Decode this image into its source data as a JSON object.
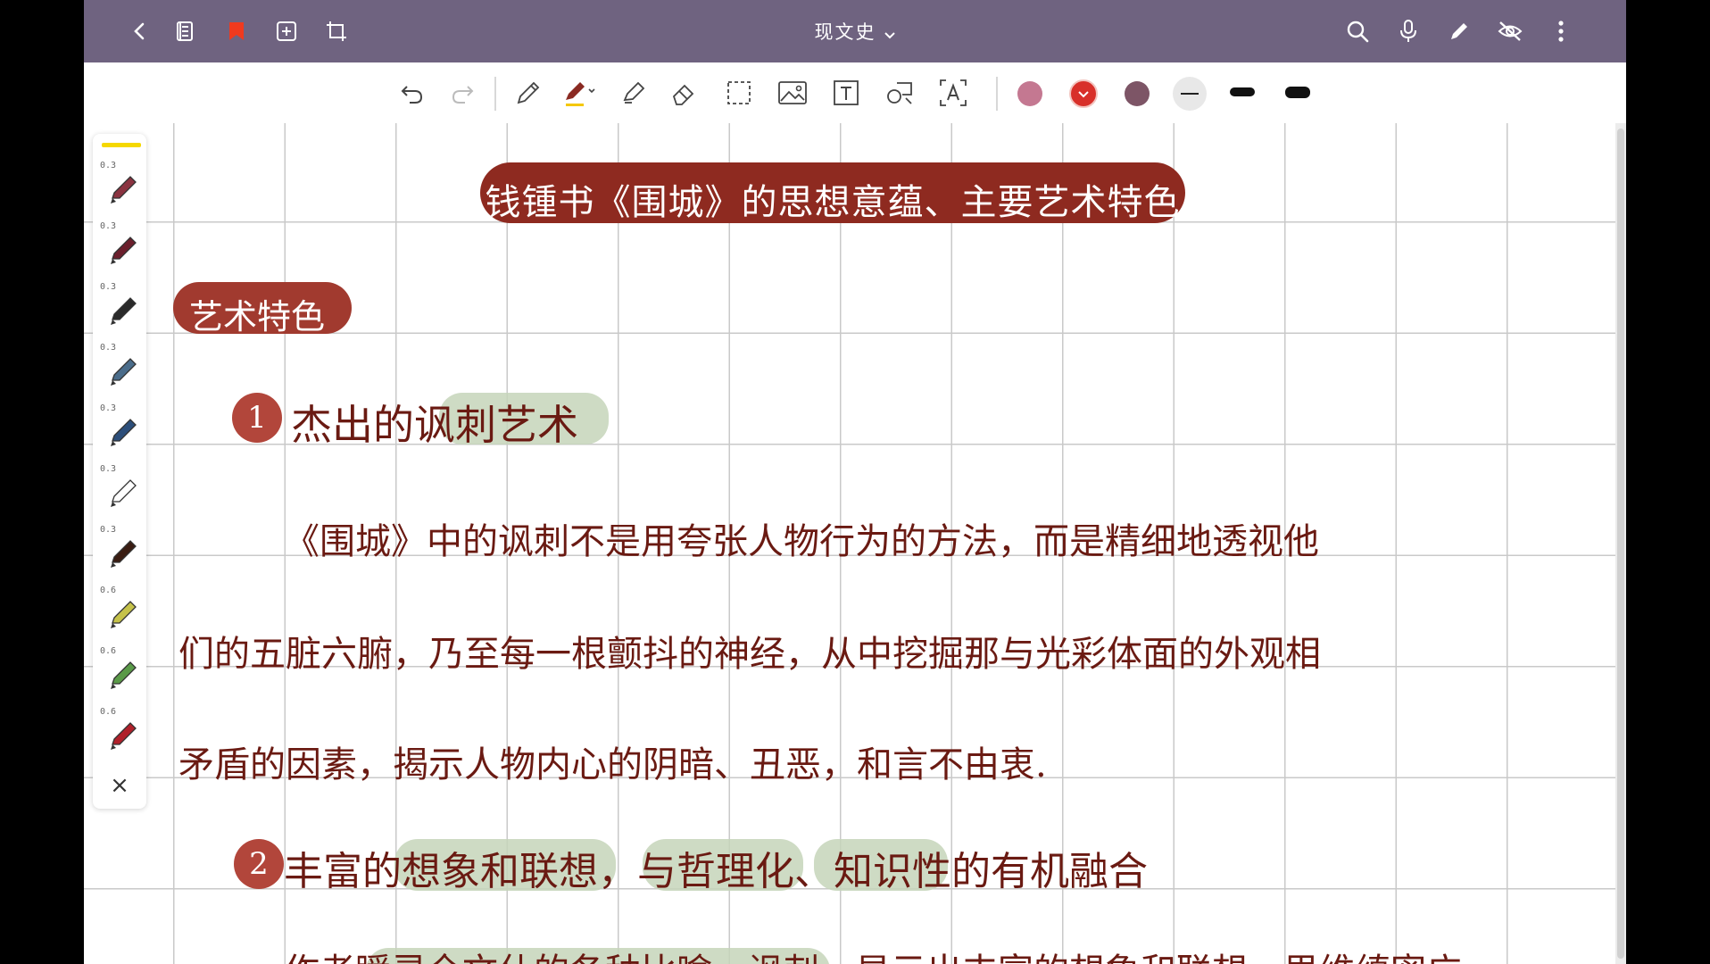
{
  "topbar": {
    "title": "现文史",
    "left_icons": [
      "back-icon",
      "pages-icon",
      "bookmark-icon",
      "add-page-icon",
      "crop-icon"
    ],
    "right_icons": [
      "search-icon",
      "microphone-icon",
      "pen-icon",
      "hide-icon",
      "more-icon"
    ]
  },
  "toolbar": {
    "tools": [
      "undo-icon",
      "redo-icon",
      "pen-tool-icon",
      "highlighter-icon",
      "marker-icon",
      "eraser-icon",
      "lasso-icon",
      "image-icon",
      "text-icon",
      "shape-icon",
      "ocr-icon"
    ],
    "colors": [
      "#c47891",
      "#d8302a",
      "#7d5566"
    ],
    "widths": [
      "thin",
      "medium",
      "thick"
    ]
  },
  "palette": {
    "pens": [
      {
        "size": "0.3",
        "color": "#8a3340"
      },
      {
        "size": "0.3",
        "color": "#6b1f2c"
      },
      {
        "size": "0.3",
        "color": "#2a2a2a"
      },
      {
        "size": "0.3",
        "color": "#4a6c8a"
      },
      {
        "size": "0.3",
        "color": "#2c4e7a"
      },
      {
        "size": "0.3",
        "color": "#ffffff"
      },
      {
        "size": "0.3",
        "color": "#3a1d12"
      },
      {
        "size": "0.6",
        "color": "#c5c24a"
      },
      {
        "size": "0.6",
        "color": "#5a9a48"
      },
      {
        "size": "0.6",
        "color": "#b0202a"
      }
    ],
    "close": "×"
  },
  "note": {
    "title": "钱锺书《围城》的思想意蕴、主要艺术特色",
    "section": "艺术特色",
    "point1_num": "1",
    "point1_text": "杰出的讽刺艺术",
    "para1_line1": "《围城》中的讽刺不是用夸张人物行为的方法，而是精细地透视他",
    "para1_line2": "们的五脏六腑，乃至每一根颤抖的神经，从中挖掘那与光彩体面的外观相",
    "para1_line3": "矛盾的因素，揭示人物内心的阴暗、丑恶，和言不由衷.",
    "point2_num": "2",
    "point2_text": "丰富的想象和联想，与哲理化、知识性的有机融合",
    "para2_line1_partial": "作者瞬灵全文仕的各种比喻、讽刺，显示出丰富的想象和联想，思维缜密广"
  }
}
